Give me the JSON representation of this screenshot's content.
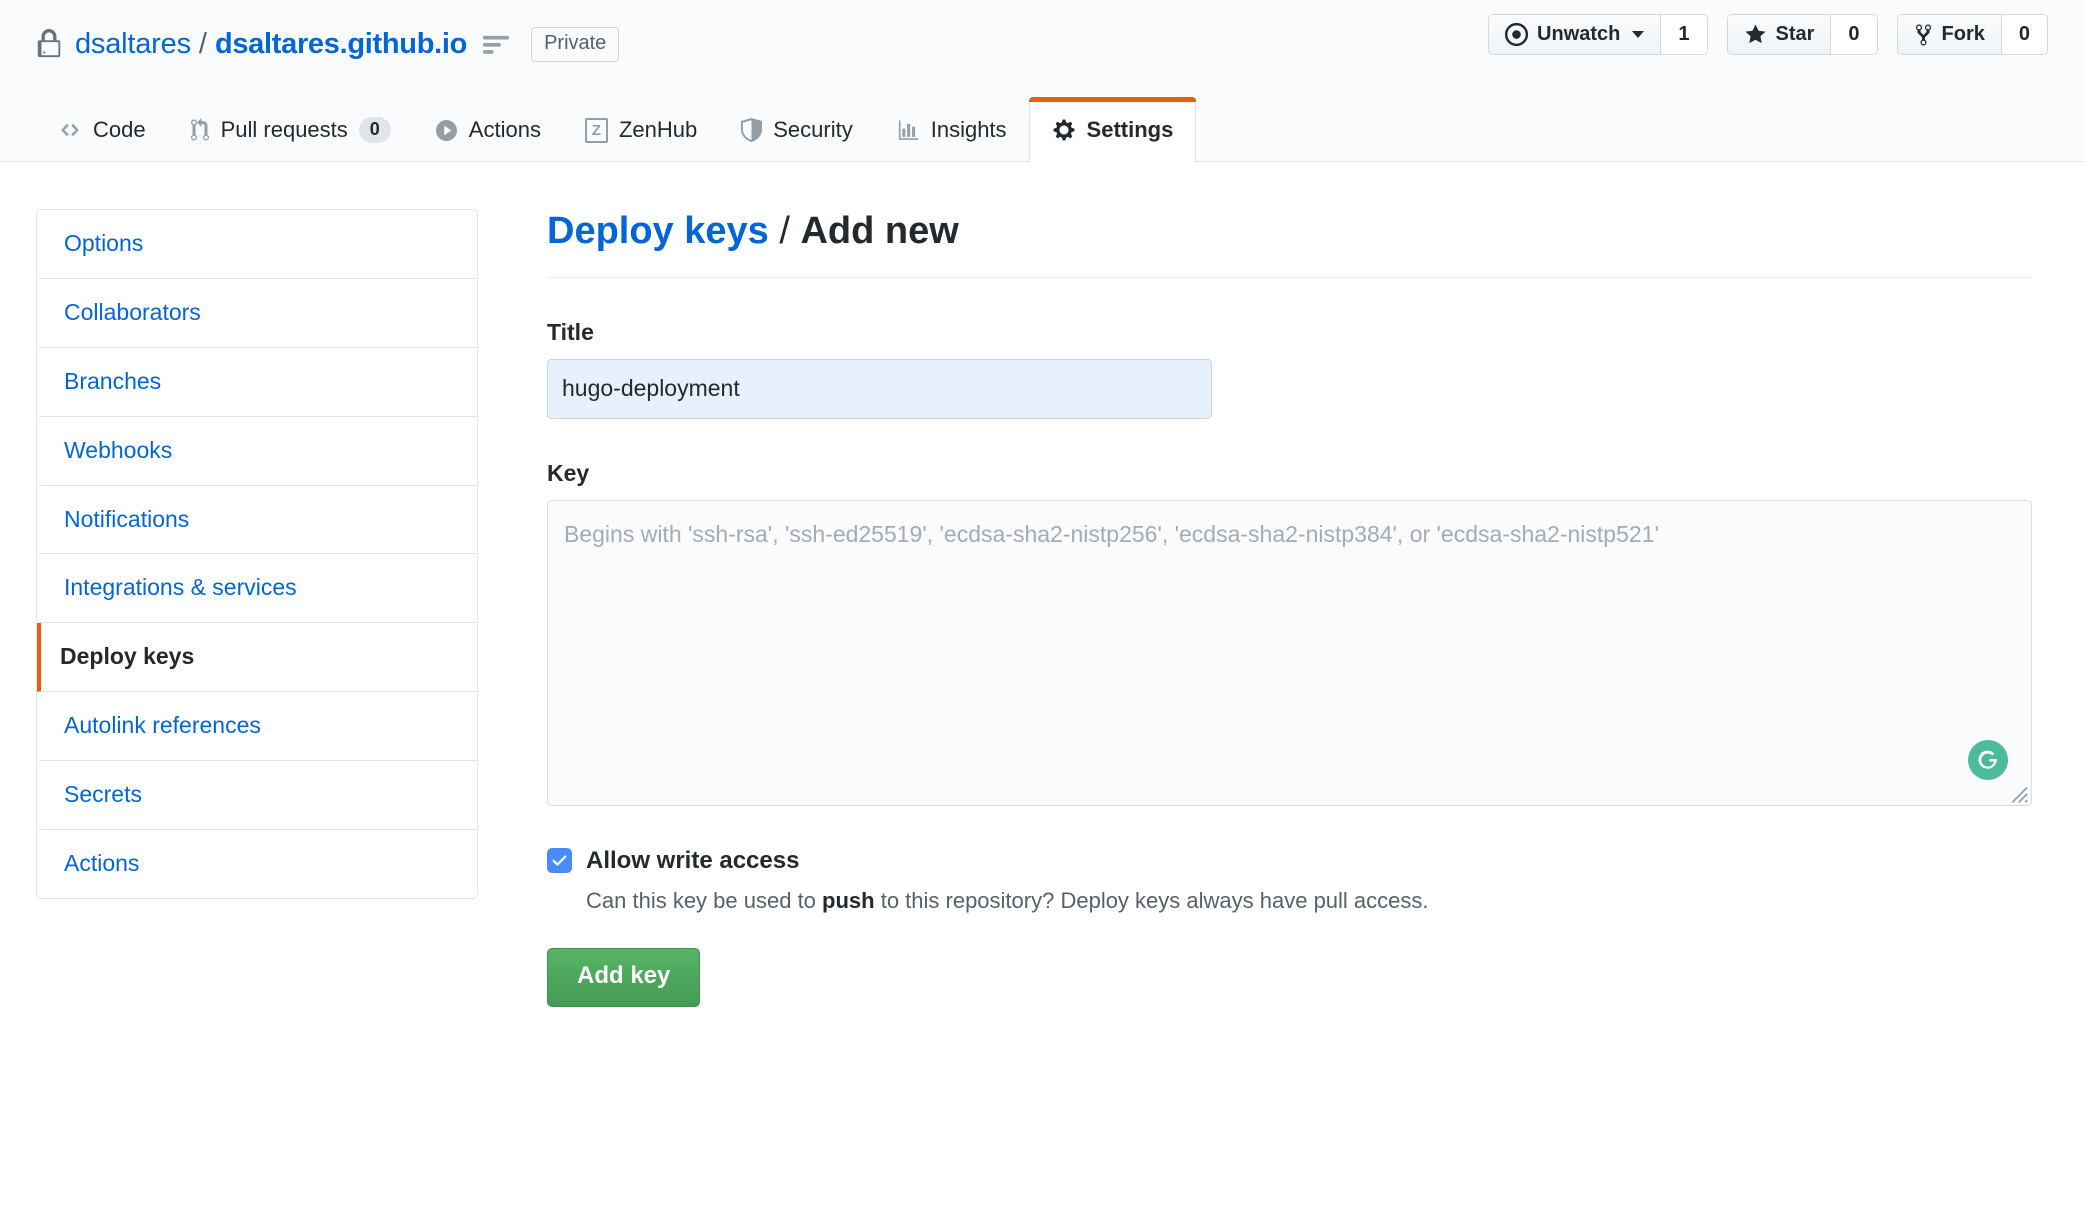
{
  "repo": {
    "owner": "dsaltares",
    "separator": "/",
    "name": "dsaltares.github.io",
    "visibility": "Private",
    "lock_icon": "lock-icon",
    "menu_icon": "repo-menu-icon"
  },
  "repo_actions": [
    {
      "label": "Unwatch",
      "count": "1",
      "icon": "eye-icon",
      "has_caret": true
    },
    {
      "label": "Star",
      "count": "0",
      "icon": "star-icon",
      "has_caret": false
    },
    {
      "label": "Fork",
      "count": "0",
      "icon": "fork-icon",
      "has_caret": false
    }
  ],
  "tabs": [
    {
      "label": "Code",
      "icon": "code-icon",
      "counter": null,
      "active": false
    },
    {
      "label": "Pull requests",
      "icon": "git-pull-request-icon",
      "counter": "0",
      "active": false
    },
    {
      "label": "Actions",
      "icon": "play-icon",
      "counter": null,
      "active": false
    },
    {
      "label": "ZenHub",
      "icon": "zenhub-icon",
      "counter": null,
      "active": false
    },
    {
      "label": "Security",
      "icon": "shield-icon",
      "counter": null,
      "active": false
    },
    {
      "label": "Insights",
      "icon": "graph-icon",
      "counter": null,
      "active": false
    },
    {
      "label": "Settings",
      "icon": "gear-icon",
      "counter": null,
      "active": true
    }
  ],
  "sidebar": {
    "items": [
      {
        "label": "Options",
        "selected": false
      },
      {
        "label": "Collaborators",
        "selected": false
      },
      {
        "label": "Branches",
        "selected": false
      },
      {
        "label": "Webhooks",
        "selected": false
      },
      {
        "label": "Notifications",
        "selected": false
      },
      {
        "label": "Integrations & services",
        "selected": false
      },
      {
        "label": "Deploy keys",
        "selected": true
      },
      {
        "label": "Autolink references",
        "selected": false
      },
      {
        "label": "Secrets",
        "selected": false
      },
      {
        "label": "Actions",
        "selected": false
      }
    ]
  },
  "main": {
    "heading_link": "Deploy keys",
    "heading_sep": " / ",
    "heading_rest": "Add new",
    "title_field": {
      "label": "Title",
      "value": "hugo-deployment",
      "placeholder": ""
    },
    "key_field": {
      "label": "Key",
      "value": "",
      "placeholder": "Begins with 'ssh-rsa', 'ssh-ed25519', 'ecdsa-sha2-nistp256', 'ecdsa-sha2-nistp384', or 'ecdsa-sha2-nistp521'"
    },
    "grammarly_icon": "grammarly-icon",
    "write_access": {
      "checked": true,
      "label": "Allow write access",
      "help_prefix": "Can this key be used to ",
      "help_bold": "push",
      "help_suffix": " to this repository? Deploy keys always have pull access."
    },
    "submit_label": "Add key"
  },
  "colors": {
    "link": "#0366d6",
    "accent_orange": "#e36209",
    "button_green": "#55b567",
    "checkbox_blue": "#4a8bfc",
    "grammarly_green": "#4cbb9b",
    "page_bg": "#fafbfc",
    "border": "#e1e4e8"
  }
}
